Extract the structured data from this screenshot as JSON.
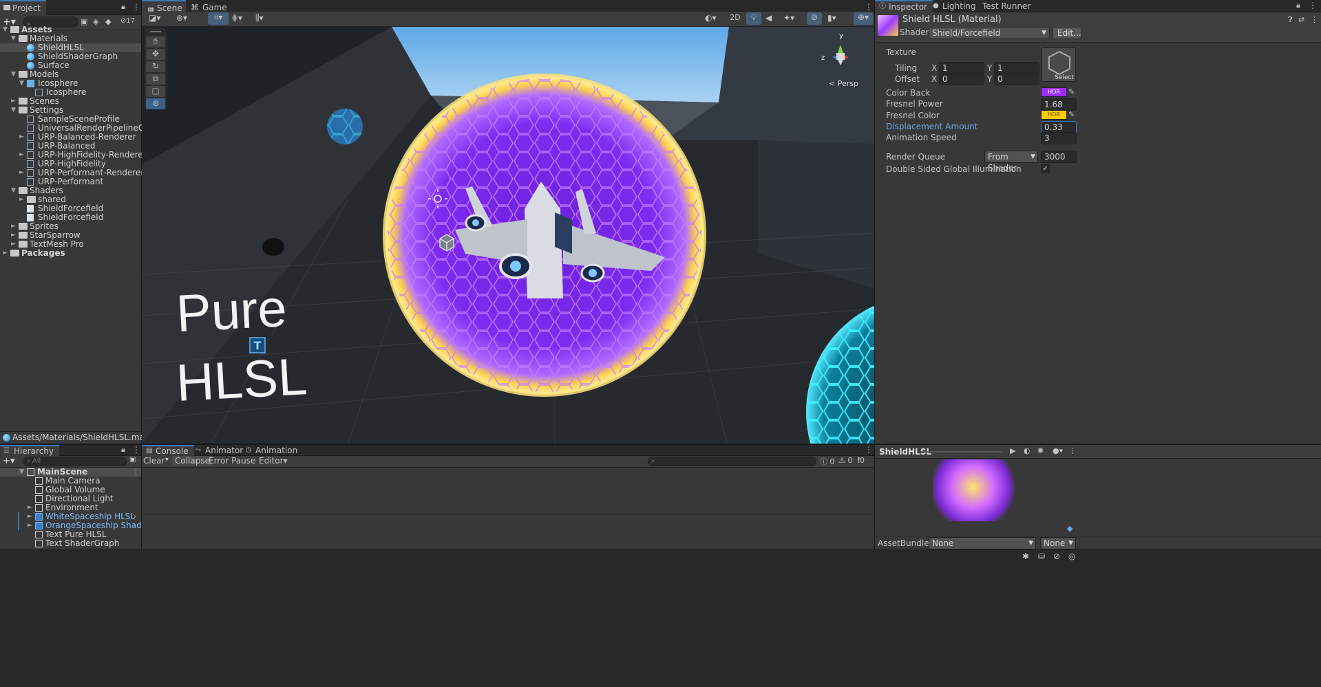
{
  "project": {
    "tab": "Project",
    "count": "17",
    "path": "Assets/Materials/ShieldHLSL.mat",
    "tree": [
      {
        "label": "Assets",
        "depth": 0,
        "icon": "folder",
        "arrow": "▼",
        "bold": true
      },
      {
        "label": "Materials",
        "depth": 1,
        "icon": "folder",
        "arrow": "▼"
      },
      {
        "label": "ShieldHLSL",
        "depth": 2,
        "icon": "sphere",
        "arrow": "",
        "selected": true
      },
      {
        "label": "ShieldShaderGraph",
        "depth": 2,
        "icon": "sphere",
        "arrow": ""
      },
      {
        "label": "Surface",
        "depth": 2,
        "icon": "sphere",
        "arrow": ""
      },
      {
        "label": "Models",
        "depth": 1,
        "icon": "folder",
        "arrow": "▼"
      },
      {
        "label": "Icosphere",
        "depth": 2,
        "icon": "cube",
        "arrow": "▼"
      },
      {
        "label": "Icosphere",
        "depth": 3,
        "icon": "grid",
        "arrow": ""
      },
      {
        "label": "Scenes",
        "depth": 1,
        "icon": "folder",
        "arrow": "►"
      },
      {
        "label": "Settings",
        "depth": 1,
        "icon": "folder",
        "arrow": "▼"
      },
      {
        "label": "SampleSceneProfile",
        "depth": 2,
        "icon": "asset",
        "arrow": ""
      },
      {
        "label": "UniversalRenderPipelineGlobalSe",
        "depth": 2,
        "icon": "asset",
        "arrow": ""
      },
      {
        "label": "URP-Balanced-Renderer",
        "depth": 2,
        "icon": "asset",
        "arrow": "►"
      },
      {
        "label": "URP-Balanced",
        "depth": 2,
        "icon": "asset",
        "arrow": ""
      },
      {
        "label": "URP-HighFidelity-Renderer",
        "depth": 2,
        "icon": "asset",
        "arrow": "►"
      },
      {
        "label": "URP-HighFidelity",
        "depth": 2,
        "icon": "asset",
        "arrow": ""
      },
      {
        "label": "URP-Performant-Renderer",
        "depth": 2,
        "icon": "asset",
        "arrow": "►"
      },
      {
        "label": "URP-Performant",
        "depth": 2,
        "icon": "asset",
        "arrow": ""
      },
      {
        "label": "Shaders",
        "depth": 1,
        "icon": "folder",
        "arrow": "▼"
      },
      {
        "label": "shared",
        "depth": 2,
        "icon": "folder",
        "arrow": "►"
      },
      {
        "label": "ShieldForcefield",
        "depth": 2,
        "icon": "shader",
        "arrow": ""
      },
      {
        "label": "ShieldForcefield",
        "depth": 2,
        "icon": "shaderS",
        "arrow": ""
      },
      {
        "label": "Sprites",
        "depth": 1,
        "icon": "folder",
        "arrow": "►"
      },
      {
        "label": "StarSparrow",
        "depth": 1,
        "icon": "folder",
        "arrow": "►"
      },
      {
        "label": "TextMesh Pro",
        "depth": 1,
        "icon": "folder",
        "arrow": "►"
      },
      {
        "label": "Packages",
        "depth": 0,
        "icon": "folder",
        "arrow": "►",
        "bold": true
      }
    ]
  },
  "scene": {
    "tabs": [
      "Scene",
      "Game"
    ],
    "btn_2d": "2D",
    "persp_label": "< Persp",
    "gizmo_y": "y",
    "gizmo_z": "z",
    "world_text_1": "Pure",
    "world_text_2": "HLSL"
  },
  "hierarchy": {
    "tab": "Hierarchy",
    "search_placeholder": "All",
    "rows": [
      {
        "label": "MainScene",
        "depth": 0,
        "arrow": "▼",
        "bold": true,
        "highlight": true
      },
      {
        "label": "Main Camera",
        "depth": 1,
        "arrow": ""
      },
      {
        "label": "Global Volume",
        "depth": 1,
        "arrow": ""
      },
      {
        "label": "Directional Light",
        "depth": 1,
        "arrow": ""
      },
      {
        "label": "Environment",
        "depth": 1,
        "arrow": "►"
      },
      {
        "label": "WhiteSpaceship HLSL",
        "depth": 1,
        "arrow": "►",
        "prefab": true
      },
      {
        "label": "OrangeSpaceship ShaderGr",
        "depth": 1,
        "arrow": "►",
        "prefab": true
      },
      {
        "label": "Text Pure HLSL",
        "depth": 1,
        "arrow": ""
      },
      {
        "label": "Text ShaderGraph",
        "depth": 1,
        "arrow": ""
      }
    ]
  },
  "console": {
    "tabs": [
      "Console",
      "Animator",
      "Animation"
    ],
    "clear": "Clear",
    "collapse": "Collapse",
    "error_pause": "Error Pause",
    "editor": "Editor",
    "count_log": "0",
    "count_warn": "0",
    "count_err": "0"
  },
  "inspector": {
    "tabs": [
      "Inspector",
      "Lighting",
      "Test Runner"
    ],
    "title": "Shield HLSL (Material)",
    "shader_label": "Shader",
    "shader_value": "Shield/Forcefield",
    "edit_btn": "Edit...",
    "texture_label": "Texture",
    "select_label": "Select",
    "tiling_label": "Tiling",
    "offset_label": "Offset",
    "x": "X",
    "y": "Y",
    "tiling_x": "1",
    "tiling_y": "1",
    "offset_x": "0",
    "offset_y": "0",
    "color_back_label": "Color Back",
    "hdr": "HDR",
    "fresnel_power_label": "Fresnel Power",
    "fresnel_power_value": "1.68",
    "fresnel_color_label": "Fresnel Color",
    "displacement_label": "Displacement Amount",
    "displacement_value": "0.33",
    "anim_speed_label": "Animation Speed",
    "anim_speed_value": "3",
    "render_queue_label": "Render Queue",
    "render_queue_mode": "From Shader",
    "render_queue_value": "3000",
    "double_sided_label": "Double Sided Global Illumination",
    "check": "✓",
    "color_back": "#9b2cff",
    "fresnel_color": "#ffcc00"
  },
  "preview": {
    "title": "ShieldHLSL",
    "assetbundle_label": "AssetBundle",
    "assetbundle_value": "None",
    "variant_value": "None"
  }
}
